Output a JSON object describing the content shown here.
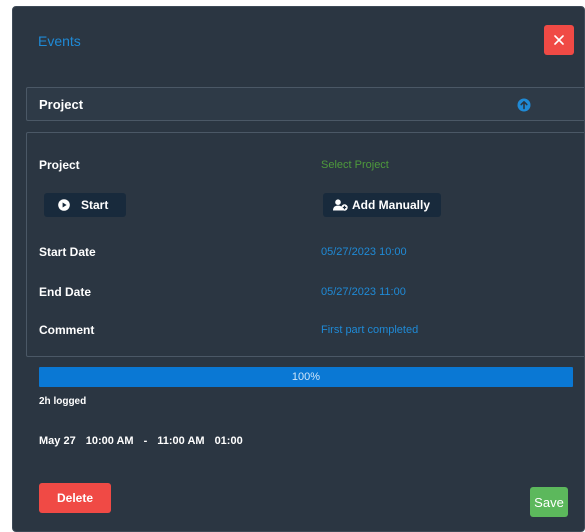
{
  "modal": {
    "title": "Events"
  },
  "section": {
    "header_label": "Project"
  },
  "fields": {
    "project_label": "Project",
    "project_value": "Select Project",
    "start_button": "Start",
    "add_manually_button": "Add Manually",
    "start_date_label": "Start Date",
    "start_date_value": "05/27/2023 10:00",
    "end_date_label": "End Date",
    "end_date_value": "05/27/2023 11:00",
    "comment_label": "Comment",
    "comment_value": "First part completed"
  },
  "progress": {
    "percent": 100,
    "label": "100%"
  },
  "summary": {
    "logged": "2h logged",
    "date": "May 27",
    "start_time": "10:00 AM",
    "separator": "-",
    "end_time": "11:00 AM",
    "duration": "01:00"
  },
  "actions": {
    "delete_label": "Delete",
    "save_label": "Save"
  },
  "colors": {
    "accent_blue": "#1f8ad6",
    "danger_red": "#f04a45",
    "success_green": "#5cb85c",
    "panel_bg": "#2b3642"
  },
  "icons": {
    "close": "close-icon",
    "collapse": "arrow-up-circle-icon",
    "start": "play-circle-icon",
    "add_manually": "user-plus-icon"
  }
}
